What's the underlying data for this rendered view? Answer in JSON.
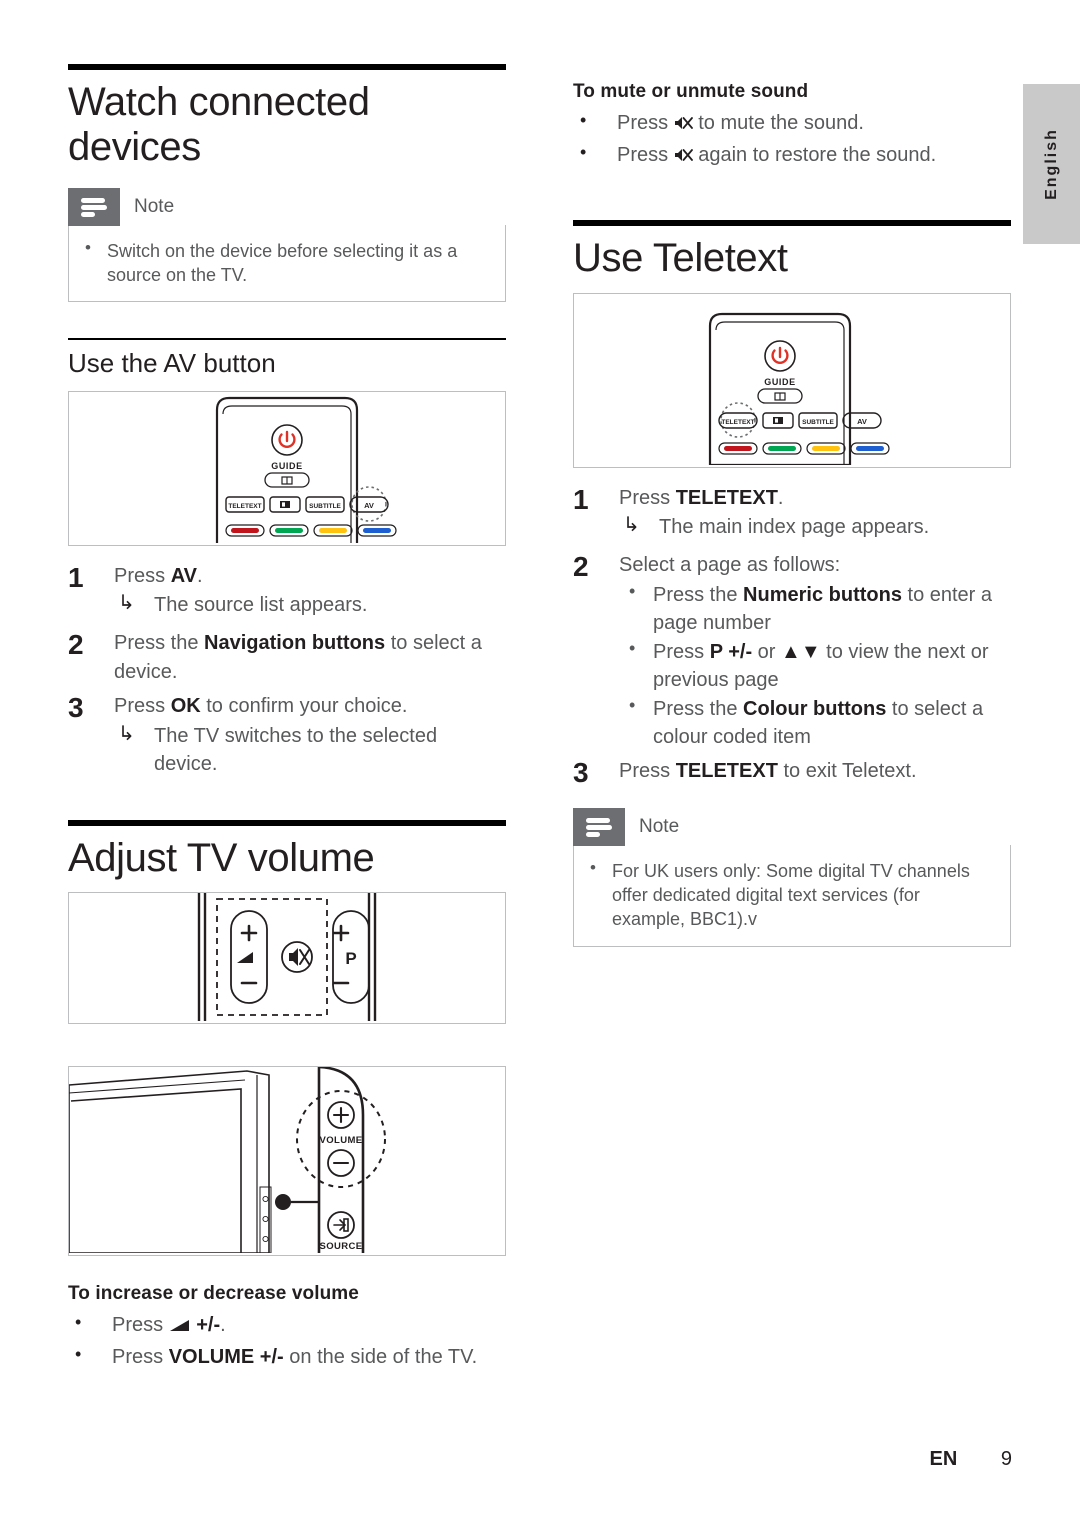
{
  "language_tab": {
    "label": "English"
  },
  "footer": {
    "lang_code": "EN",
    "page_number": "9"
  },
  "left_column": {
    "main_heading": "Watch connected devices",
    "note": {
      "title": "Note",
      "icon": "note-lines-icon",
      "items": [
        "Switch on the device before selecting it as a source on the TV."
      ]
    },
    "sub_heading": "Use the AV button",
    "figure": {
      "name": "remote-control-av-figure",
      "power_button_label": "power-icon",
      "guide_label": "GUIDE",
      "guide_icon": "book-icon",
      "buttons": [
        "TELETEXT",
        "dual-screen-icon",
        "SUBTITLE",
        "AV"
      ],
      "highlighted_button": "AV",
      "colour_buttons": [
        "#c0151c",
        "#00a651",
        "#ffc20e",
        "#1d5fd0"
      ]
    },
    "steps": [
      {
        "num": "1",
        "text_parts": [
          {
            "t": "Press ",
            "b": false
          },
          {
            "t": "AV",
            "b": true
          },
          {
            "t": ".",
            "b": false
          }
        ],
        "result": "The source list appears."
      },
      {
        "num": "2",
        "text_parts": [
          {
            "t": "Press the ",
            "b": false
          },
          {
            "t": "Navigation buttons",
            "b": true
          },
          {
            "t": " to select a device.",
            "b": false
          }
        ],
        "result": ""
      },
      {
        "num": "3",
        "text_parts": [
          {
            "t": "Press ",
            "b": false
          },
          {
            "t": "OK",
            "b": true
          },
          {
            "t": " to confirm your choice.",
            "b": false
          }
        ],
        "result": "The TV switches to the selected device."
      }
    ],
    "volume_heading": "Adjust TV volume",
    "volume_figure": {
      "name": "remote-volume-figure",
      "volume_plus": "+",
      "volume_icon": "volume-wedge-icon",
      "volume_minus": "−",
      "mute_icon": "mute-icon",
      "program_plus": "+",
      "program_label": "P",
      "program_minus": "−"
    },
    "tv_side_figure": {
      "name": "tv-side-panel-figure",
      "volume_label": "VOLUME",
      "volume_plus": "+",
      "volume_minus": "−",
      "source_label": "SOURCE",
      "source_icon": "source-icon"
    },
    "volume_minor_heading": "To increase or decrease volume",
    "volume_bullets": [
      {
        "parts": [
          {
            "t": "Press ",
            "b": false
          },
          {
            "t": "◢",
            "b": false,
            "glyph": true
          },
          {
            "t": " +/-",
            "b": true
          },
          {
            "t": ".",
            "b": false
          }
        ]
      },
      {
        "parts": [
          {
            "t": "Press ",
            "b": false
          },
          {
            "t": "VOLUME +/-",
            "b": true
          },
          {
            "t": " on the side of the TV.",
            "b": false
          }
        ]
      }
    ]
  },
  "right_column": {
    "mute_heading": "To mute or unmute sound",
    "mute_bullets": [
      {
        "parts": [
          {
            "t": "Press ",
            "b": false
          },
          {
            "t": "mute-icon",
            "b": false,
            "icon": true
          },
          {
            "t": " to mute the sound.",
            "b": false
          }
        ]
      },
      {
        "parts": [
          {
            "t": "Press ",
            "b": false
          },
          {
            "t": "mute-icon",
            "b": false,
            "icon": true
          },
          {
            "t": " again to restore the sound.",
            "b": false
          }
        ]
      }
    ],
    "teletext_heading": "Use Teletext",
    "teletext_figure": {
      "name": "remote-control-teletext-figure",
      "power_button_label": "power-icon",
      "guide_label": "GUIDE",
      "guide_icon": "book-icon",
      "buttons": [
        "TELETEXT",
        "dual-screen-icon",
        "SUBTITLE",
        "AV"
      ],
      "highlighted_button": "TELETEXT",
      "colour_buttons": [
        "#c0151c",
        "#00a651",
        "#ffc20e",
        "#1d5fd0"
      ]
    },
    "steps": [
      {
        "num": "1",
        "text_parts": [
          {
            "t": "Press ",
            "b": false
          },
          {
            "t": "TELETEXT",
            "b": true
          },
          {
            "t": ".",
            "b": false
          }
        ],
        "result": "The main index page appears.",
        "bullets": []
      },
      {
        "num": "2",
        "text_parts": [
          {
            "t": "Select a page as follows:",
            "b": false
          }
        ],
        "result": "",
        "bullets": [
          {
            "parts": [
              {
                "t": "Press the ",
                "b": false
              },
              {
                "t": "Numeric buttons",
                "b": true
              },
              {
                "t": " to enter a page number",
                "b": false
              }
            ]
          },
          {
            "parts": [
              {
                "t": "Press ",
                "b": false
              },
              {
                "t": "P +/-",
                "b": true
              },
              {
                "t": " or ",
                "b": false
              },
              {
                "t": "▲▼",
                "b": true
              },
              {
                "t": " to view the next or previous page",
                "b": false
              }
            ]
          },
          {
            "parts": [
              {
                "t": "Press the ",
                "b": false
              },
              {
                "t": "Colour buttons",
                "b": true
              },
              {
                "t": " to select a colour coded item",
                "b": false
              }
            ]
          }
        ]
      },
      {
        "num": "3",
        "text_parts": [
          {
            "t": "Press ",
            "b": false
          },
          {
            "t": "TELETEXT",
            "b": true
          },
          {
            "t": " to exit Teletext.",
            "b": false
          }
        ],
        "result": "",
        "bullets": []
      }
    ],
    "note": {
      "title": "Note",
      "icon": "note-lines-icon",
      "items": [
        "For UK users only: Some digital TV channels offer dedicated digital text services (for example, BBC1).v"
      ]
    }
  },
  "colors": {
    "note_tab": "#6d6e71",
    "note_border": "#bcbec0",
    "body_text": "#58595b",
    "heading_text": "#231f20",
    "power_red": "#e03127",
    "lang_tab_bg": "#c9c9c9"
  }
}
